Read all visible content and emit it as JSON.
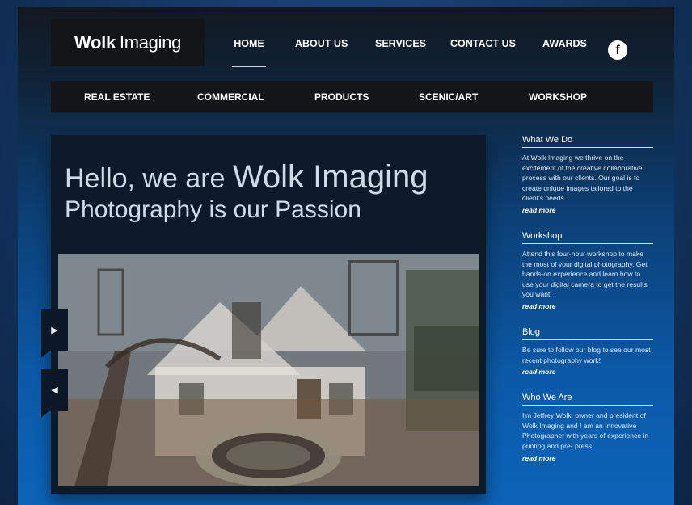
{
  "logo": {
    "bold": "Wolk",
    "light": "Imaging"
  },
  "top_nav": [
    {
      "label": "HOME",
      "active": true
    },
    {
      "label": "ABOUT US",
      "active": false
    },
    {
      "label": "SERVICES",
      "active": false
    },
    {
      "label": "CONTACT US",
      "active": false
    },
    {
      "label": "AWARDS",
      "active": false
    }
  ],
  "social": {
    "facebook_glyph": "f",
    "icon": "facebook-icon"
  },
  "sub_nav": [
    {
      "label": "REAL ESTATE"
    },
    {
      "label": "COMMERCIAL"
    },
    {
      "label": "PRODUCTS"
    },
    {
      "label": "SCENIC/ART"
    },
    {
      "label": "WORKSHOP"
    }
  ],
  "hero": {
    "line1_prefix": "Hello, we are",
    "line1_brand": "Wolk Imaging",
    "line2": "Photography is our Passion",
    "next_glyph": "▶",
    "prev_glyph": "◀"
  },
  "sidebar": [
    {
      "title": "What We Do",
      "text": "At Wolk Imaging we thrive on the excitement of the creative collaborative process with our clients. Our goal is to create unique images tailored to the client's needs.",
      "link": "read more"
    },
    {
      "title": "Workshop",
      "text": "Attend this four-hour workshop to make the most of your digital photography. Get hands-on experience and learn how to use your digital camera to get the results you want.",
      "link": "read more"
    },
    {
      "title": "Blog",
      "text": "Be sure to follow our blog to see our most recent photography work!",
      "link": "read more"
    },
    {
      "title": "Who We Are",
      "text": "I'm Jeffrey Wolk, owner and president of Wolk Imaging and I am an Innovative Photographer with years of experience in printing and pre- press.",
      "link": "read more"
    }
  ]
}
